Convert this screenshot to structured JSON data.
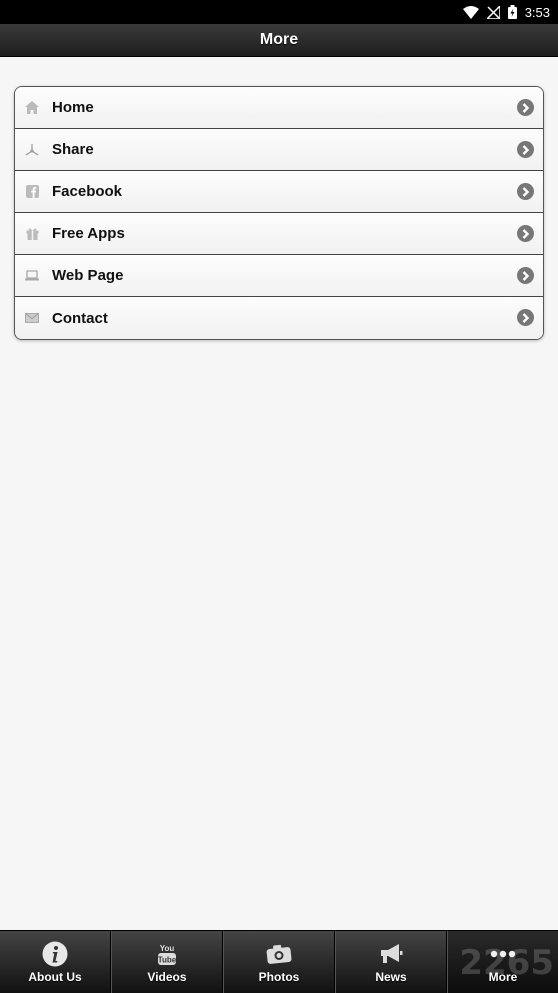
{
  "status_bar": {
    "time": "3:53",
    "icons": [
      "wifi-icon",
      "no-signal-icon",
      "battery-icon"
    ]
  },
  "header": {
    "title": "More"
  },
  "menu": {
    "items": [
      {
        "label": "Home",
        "icon": "home-icon"
      },
      {
        "label": "Share",
        "icon": "share-icon"
      },
      {
        "label": "Facebook",
        "icon": "facebook-icon"
      },
      {
        "label": "Free Apps",
        "icon": "gift-icon"
      },
      {
        "label": "Web Page",
        "icon": "laptop-icon"
      },
      {
        "label": "Contact",
        "icon": "mail-icon"
      }
    ]
  },
  "tabs": [
    {
      "label": "About Us",
      "icon": "info-icon"
    },
    {
      "label": "Videos",
      "icon": "youtube-icon"
    },
    {
      "label": "Photos",
      "icon": "camera-icon"
    },
    {
      "label": "News",
      "icon": "megaphone-icon"
    },
    {
      "label": "More",
      "icon": "more-dots-icon",
      "active": true
    }
  ],
  "watermark": "2265",
  "colors": {
    "header_bg": "#2b2b2b",
    "page_bg": "#f6f6f6",
    "chevron": "#777777"
  }
}
